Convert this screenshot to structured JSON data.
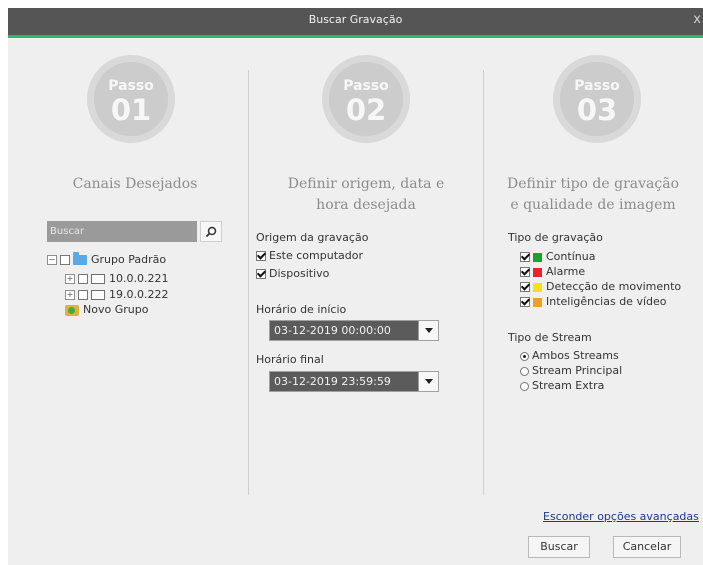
{
  "window": {
    "title": "Buscar Gravação",
    "close_label": "x"
  },
  "steps": [
    {
      "word": "Passo",
      "number": "01",
      "heading_lines": [
        "Canais Desejados"
      ]
    },
    {
      "word": "Passo",
      "number": "02",
      "heading_lines": [
        "Definir origem, data e",
        "hora desejada"
      ]
    },
    {
      "word": "Passo",
      "number": "03",
      "heading_lines": [
        "Definir tipo de gravação",
        "e qualidade de imagem"
      ]
    }
  ],
  "channels": {
    "search_placeholder": "Buscar",
    "tree": [
      {
        "label": "Grupo Padrão",
        "expander": "−",
        "type": "group"
      },
      {
        "label": "10.0.0.221",
        "expander": "+",
        "type": "device"
      },
      {
        "label": "19.0.0.222",
        "expander": "+",
        "type": "device"
      },
      {
        "label": "Novo Grupo",
        "type": "add-group"
      }
    ]
  },
  "origin": {
    "label": "Origem da gravação",
    "options": [
      {
        "label": "Este computador",
        "checked": true
      },
      {
        "label": "Dispositivo",
        "checked": true
      }
    ],
    "start_label": "Horário de início",
    "start_value": "03-12-2019 00:00:00",
    "end_label": "Horário final",
    "end_value": "03-12-2019 23:59:59"
  },
  "record_types": {
    "label": "Tipo de gravação",
    "items": [
      {
        "label": "Contínua",
        "checked": true,
        "color": "#1fa02e"
      },
      {
        "label": "Alarme",
        "checked": true,
        "color": "#e8242a"
      },
      {
        "label": "Detecção de movimento",
        "checked": true,
        "color": "#f4e11c"
      },
      {
        "label": "Inteligências de vídeo",
        "checked": true,
        "color": "#f39b2b"
      }
    ]
  },
  "stream": {
    "label": "Tipo de Stream",
    "options": [
      {
        "label": "Ambos Streams",
        "selected": true
      },
      {
        "label": "Stream Principal",
        "selected": false
      },
      {
        "label": "Stream Extra",
        "selected": false
      }
    ]
  },
  "advanced_link": "Esconder opções avançadas",
  "buttons": {
    "search": "Buscar",
    "cancel": "Cancelar"
  }
}
